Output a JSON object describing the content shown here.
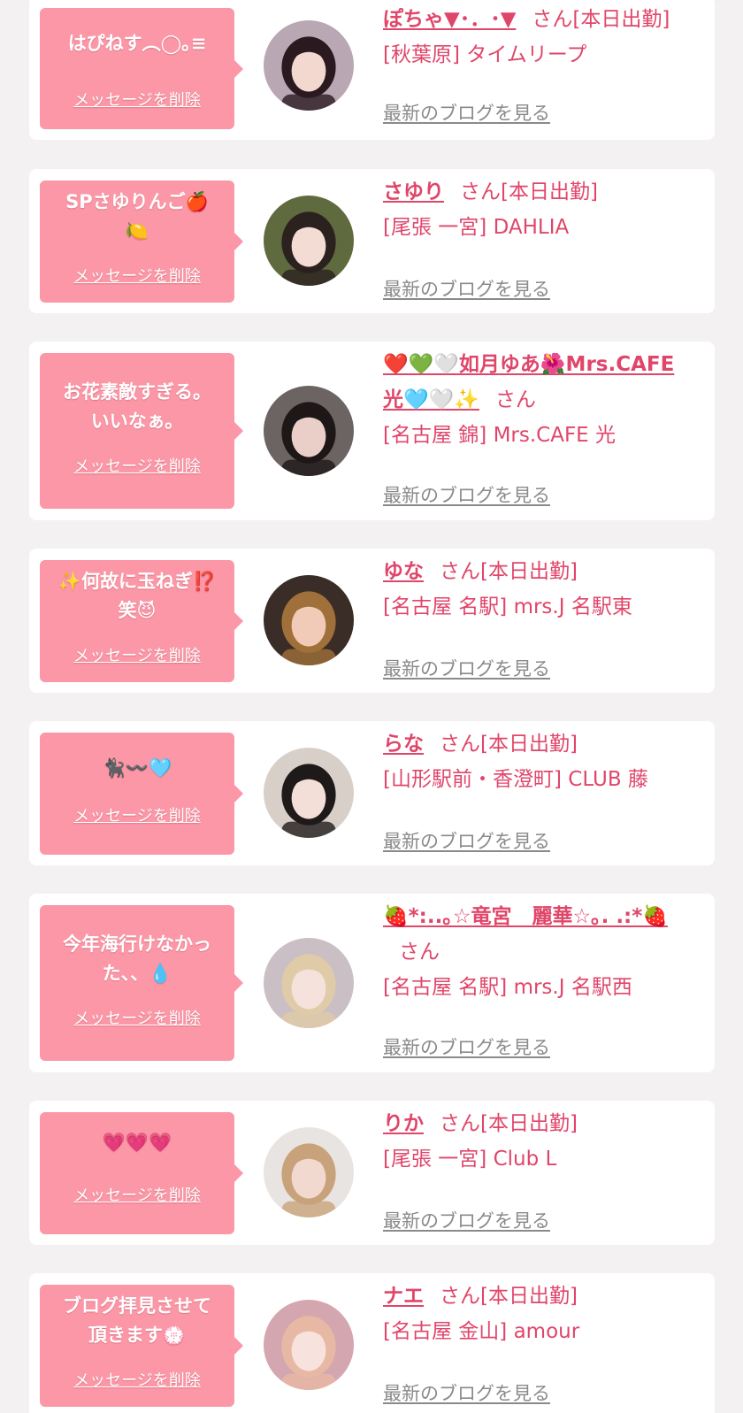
{
  "common": {
    "delete_label": "メッセージを削除",
    "blog_label": "最新のブログを見る",
    "san_label": "さん",
    "status_label": "[本日出勤]"
  },
  "colors": {
    "bubble": "#fb97a6",
    "name": "#e0466a",
    "blog_link": "#8a8a8a",
    "background": "#f3f1f2"
  },
  "cards": [
    {
      "message": "はぴねす︵◯｡≡",
      "name": "ぽちゃ▼･．･▼",
      "show_status": true,
      "shop": "[秋葉原] タイムリープ",
      "avatar": {
        "bg": "#b9a7b4",
        "hair": "#2a1a20",
        "skin": "#f3d8d0"
      }
    },
    {
      "message": "SPさゆりんご🍎\n🍋",
      "name": "さゆり",
      "show_status": true,
      "shop": "[尾張 一宮] DAHLIA",
      "avatar": {
        "bg": "#5f6b3f",
        "hair": "#2b211f",
        "skin": "#f2dcd3"
      }
    },
    {
      "message": "お花素敵すぎる。\nいいなぁ。",
      "name": "❤️💚🤍如月ゆあ🌺Mrs.CAFE 光🩵🤍✨",
      "show_status": false,
      "shop": "[名古屋 錦] Mrs.CAFE 光",
      "avatar": {
        "bg": "#6b6462",
        "hair": "#1e1718",
        "skin": "#e9cfc8"
      }
    },
    {
      "message": "✨何故に玉ねぎ⁉️\n笑😈",
      "name": "ゆな",
      "show_status": true,
      "shop": "[名古屋 名駅] mrs.J 名駅東",
      "avatar": {
        "bg": "#3a2c26",
        "hair": "#a0703a",
        "skin": "#f2cbb8"
      }
    },
    {
      "message": "🐈‍⬛〰️🩵",
      "name": "らな",
      "show_status": true,
      "shop": "[山形駅前・香澄町] CLUB 藤",
      "avatar": {
        "bg": "#d9cfc9",
        "hair": "#1f1a1a",
        "skin": "#f3dfd8"
      }
    },
    {
      "message": "今年海行けなかっ\nた、、💧",
      "name": "🍓*:..｡☆竜宮　麗華☆｡. .:*🍓",
      "show_status": false,
      "shop": "[名古屋 名駅] mrs.J 名駅西",
      "avatar": {
        "bg": "#c9bfc4",
        "hair": "#e0cba8",
        "skin": "#f5e2dc"
      }
    },
    {
      "message": "💗💗💗",
      "name": "りか",
      "show_status": true,
      "shop": "[尾張 一宮] Club L",
      "avatar": {
        "bg": "#e8e4e2",
        "hair": "#c8a27a",
        "skin": "#f1d9cf"
      }
    },
    {
      "message": "ブログ拝見させて\n頂きます💮",
      "name": "ナエ",
      "show_status": true,
      "shop": "[名古屋 金山] amour",
      "avatar": {
        "bg": "#d4a7b0",
        "hair": "#e7b9a4",
        "skin": "#f7e2de"
      }
    }
  ]
}
